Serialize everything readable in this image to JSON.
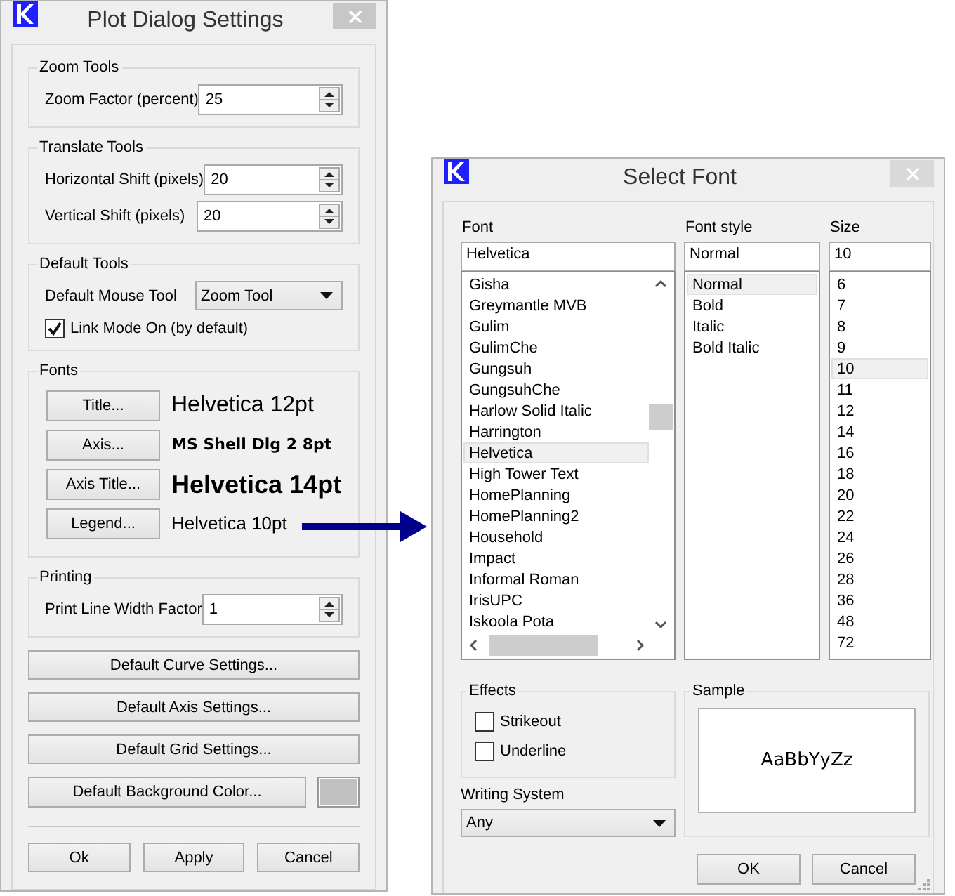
{
  "plot_dialog": {
    "title": "Plot Dialog Settings",
    "zoom_tools": {
      "legend": "Zoom Tools",
      "fields": [
        {
          "label": "Zoom Factor (percent)",
          "value": "25"
        }
      ]
    },
    "translate_tools": {
      "legend": "Translate Tools",
      "fields": [
        {
          "label": "Horizontal Shift (pixels)",
          "value": "20"
        },
        {
          "label": "Vertical Shift (pixels)",
          "value": "20"
        }
      ]
    },
    "default_tools": {
      "legend": "Default Tools",
      "mouse_tool": {
        "label": "Default Mouse Tool",
        "value": "Zoom Tool"
      },
      "link_mode": {
        "label": "Link Mode On (by default)",
        "checked": true
      }
    },
    "fonts": {
      "legend": "Fonts",
      "rows": [
        {
          "kind": "title",
          "button": "Title...",
          "sample": "Helvetica 12pt"
        },
        {
          "kind": "axis",
          "button": "Axis...",
          "sample": "MS Shell Dlg 2 8pt"
        },
        {
          "kind": "axis_title",
          "button": "Axis Title...",
          "sample": "Helvetica 14pt"
        },
        {
          "kind": "legend",
          "button": "Legend...",
          "sample": "Helvetica 10pt"
        }
      ]
    },
    "printing": {
      "legend": "Printing",
      "fields": [
        {
          "label": "Print Line Width Factor",
          "value": "1"
        }
      ]
    },
    "buttons": [
      "Default Curve Settings...",
      "Default Axis Settings...",
      "Default Grid Settings..."
    ],
    "background": {
      "button": "Default Background Color...",
      "color": "#c0c0c0"
    },
    "footer_buttons": [
      "Ok",
      "Apply",
      "Cancel"
    ]
  },
  "font_dialog": {
    "title": "Select Font",
    "font": {
      "label": "Font",
      "value": "Helvetica",
      "items": [
        {
          "name": "Gisha",
          "selected": false
        },
        {
          "name": "Greymantle MVB",
          "selected": false
        },
        {
          "name": "Gulim",
          "selected": false
        },
        {
          "name": "GulimChe",
          "selected": false
        },
        {
          "name": "Gungsuh",
          "selected": false
        },
        {
          "name": "GungsuhChe",
          "selected": false
        },
        {
          "name": "Harlow Solid Italic",
          "selected": false
        },
        {
          "name": "Harrington",
          "selected": false
        },
        {
          "name": "Helvetica",
          "selected": true
        },
        {
          "name": "High Tower Text",
          "selected": false
        },
        {
          "name": "HomePlanning",
          "selected": false
        },
        {
          "name": "HomePlanning2",
          "selected": false
        },
        {
          "name": "Household",
          "selected": false
        },
        {
          "name": "Impact",
          "selected": false
        },
        {
          "name": "Informal Roman",
          "selected": false
        },
        {
          "name": "IrisUPC",
          "selected": false
        },
        {
          "name": "Iskoola Pota",
          "selected": false
        }
      ]
    },
    "style": {
      "label": "Font style",
      "value": "Normal",
      "items": [
        {
          "name": "Normal",
          "selected": true
        },
        {
          "name": "Bold",
          "selected": false
        },
        {
          "name": "Italic",
          "selected": false
        },
        {
          "name": "Bold Italic",
          "selected": false
        }
      ]
    },
    "size": {
      "label": "Size",
      "value": "10",
      "items": [
        {
          "name": "6",
          "selected": false
        },
        {
          "name": "7",
          "selected": false
        },
        {
          "name": "8",
          "selected": false
        },
        {
          "name": "9",
          "selected": false
        },
        {
          "name": "10",
          "selected": true
        },
        {
          "name": "11",
          "selected": false
        },
        {
          "name": "12",
          "selected": false
        },
        {
          "name": "14",
          "selected": false
        },
        {
          "name": "16",
          "selected": false
        },
        {
          "name": "18",
          "selected": false
        },
        {
          "name": "20",
          "selected": false
        },
        {
          "name": "22",
          "selected": false
        },
        {
          "name": "24",
          "selected": false
        },
        {
          "name": "26",
          "selected": false
        },
        {
          "name": "28",
          "selected": false
        },
        {
          "name": "36",
          "selected": false
        },
        {
          "name": "48",
          "selected": false
        },
        {
          "name": "72",
          "selected": false
        }
      ]
    },
    "effects": {
      "legend": "Effects",
      "options": [
        {
          "label": "Strikeout",
          "checked": false
        },
        {
          "label": "Underline",
          "checked": false
        }
      ]
    },
    "writing_system": {
      "label": "Writing System",
      "value": "Any"
    },
    "sample": {
      "legend": "Sample",
      "text": "AaBbYyZz"
    },
    "buttons": [
      "OK",
      "Cancel"
    ]
  }
}
